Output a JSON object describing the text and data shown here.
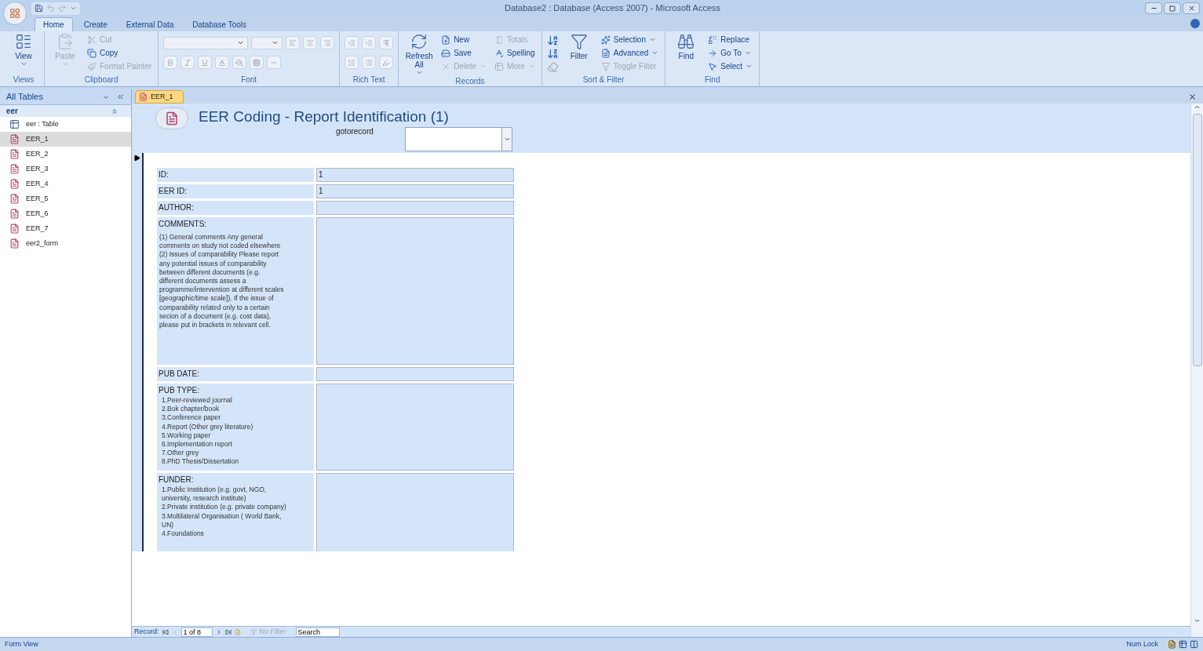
{
  "window": {
    "title": "Database2 : Database (Access 2007) - Microsoft Access"
  },
  "ribbon_tabs": [
    {
      "label": "Home",
      "selected": true
    },
    {
      "label": "Create",
      "selected": false
    },
    {
      "label": "External Data",
      "selected": false
    },
    {
      "label": "Database Tools",
      "selected": false
    }
  ],
  "ribbon_groups": [
    {
      "label": "Views",
      "items": [
        {
          "kind": "large",
          "label": "View",
          "disabled": false,
          "dropdown": true
        }
      ]
    },
    {
      "label": "Clipboard",
      "items": [
        {
          "kind": "large",
          "label": "Paste",
          "disabled": true,
          "dropdown": true
        },
        {
          "kind": "small",
          "label": "Cut",
          "disabled": true,
          "dropdown": false
        },
        {
          "kind": "small",
          "label": "Copy",
          "disabled": false,
          "dropdown": false
        },
        {
          "kind": "small",
          "label": "Format Painter",
          "disabled": true,
          "dropdown": false
        }
      ]
    },
    {
      "label": "Font",
      "items": [
        {
          "kind": "font"
        }
      ]
    },
    {
      "label": "Rich Text",
      "items": [
        {
          "kind": "richtext"
        }
      ]
    },
    {
      "label": "Records",
      "items": [
        {
          "kind": "large",
          "label": "Refresh All",
          "disabled": false,
          "dropdown": true
        },
        {
          "kind": "small",
          "label": "New",
          "disabled": false,
          "dropdown": false
        },
        {
          "kind": "small",
          "label": "Save",
          "disabled": false,
          "dropdown": false
        },
        {
          "kind": "small",
          "label": "Delete",
          "disabled": true,
          "dropdown": true
        },
        {
          "kind": "small",
          "label": "Totals",
          "disabled": true,
          "dropdown": false
        },
        {
          "kind": "small",
          "label": "Spelling",
          "disabled": false,
          "dropdown": false
        },
        {
          "kind": "small",
          "label": "More",
          "disabled": true,
          "dropdown": true
        }
      ]
    },
    {
      "label": "Sort & Filter",
      "items": [
        {
          "kind": "sort"
        },
        {
          "kind": "large",
          "label": "Filter",
          "disabled": false,
          "dropdown": false
        },
        {
          "kind": "small",
          "label": "Selection",
          "disabled": false,
          "dropdown": true
        },
        {
          "kind": "small",
          "label": "Advanced",
          "disabled": false,
          "dropdown": true
        },
        {
          "kind": "small",
          "label": "Toggle Filter",
          "disabled": true,
          "dropdown": false
        }
      ]
    },
    {
      "label": "Find",
      "items": [
        {
          "kind": "large",
          "label": "Find",
          "disabled": false,
          "dropdown": false
        },
        {
          "kind": "small",
          "label": "Replace",
          "disabled": false,
          "dropdown": false
        },
        {
          "kind": "small",
          "label": "Go To",
          "disabled": false,
          "dropdown": true
        },
        {
          "kind": "small",
          "label": "Select",
          "disabled": false,
          "dropdown": true
        }
      ]
    }
  ],
  "nav_pane": {
    "title": "All Tables",
    "group": "eer",
    "items": [
      {
        "kind": "table",
        "label": "eer : Table",
        "selected": false
      },
      {
        "kind": "form",
        "label": "EER_1",
        "selected": true
      },
      {
        "kind": "form",
        "label": "EER_2",
        "selected": false
      },
      {
        "kind": "form",
        "label": "EER_3",
        "selected": false
      },
      {
        "kind": "form",
        "label": "EER_4",
        "selected": false
      },
      {
        "kind": "form",
        "label": "EER_5",
        "selected": false
      },
      {
        "kind": "form",
        "label": "EER_6",
        "selected": false
      },
      {
        "kind": "form",
        "label": "EER_7",
        "selected": false
      },
      {
        "kind": "form",
        "label": "eer2_form",
        "selected": false
      }
    ]
  },
  "document_tab": {
    "label": "EER_1"
  },
  "form": {
    "title": "EER Coding - Report Identification (1)",
    "goto_label": "gotorecord",
    "fields": [
      {
        "kind": "short",
        "label": "ID:",
        "value": "1"
      },
      {
        "kind": "short",
        "label": "EER ID:",
        "value": "1"
      },
      {
        "kind": "short",
        "label": "AUTHOR:"
      },
      {
        "kind": "tall",
        "label": "COMMENTS:",
        "help": [
          "(1) General comments  Any general comments on study not coded elsewhere",
          "(2) Issues of comparability Please report any potential issues of comparability between different documents (e.g. different documents assess a programme/intervention at different scales [geographic/time scale]). If the issue of comparability related only to a certain secion of a document (e.g. cost data), please put in brackets in relevant cell."
        ]
      },
      {
        "kind": "short",
        "label": "PUB DATE:"
      },
      {
        "kind": "list",
        "label": "PUB TYPE:",
        "help": [
          "1.Peer-reviewed journal",
          "2.Bok chapter/book",
          "3.Conference paper",
          "4.Report (Other grey literature)",
          "5.Working paper",
          "6.Implementation report",
          "7.Other grey",
          "8.PhD Thesis/Dissertation"
        ]
      },
      {
        "kind": "list",
        "label": "FUNDER:",
        "help": [
          "1.Public Institution (e.g. govt, NGO, university, research institute)",
          "2.Private institution (e.g. private company)",
          "3.Multilateral Organisation ( World Bank, UN)",
          "4.Foundations"
        ]
      }
    ]
  },
  "record_nav": {
    "label": "Record:",
    "position": "1 of 8",
    "filter": "No Filter",
    "search": "Search"
  },
  "status_bar": {
    "view": "Form View",
    "num_lock": "Num Lock"
  }
}
